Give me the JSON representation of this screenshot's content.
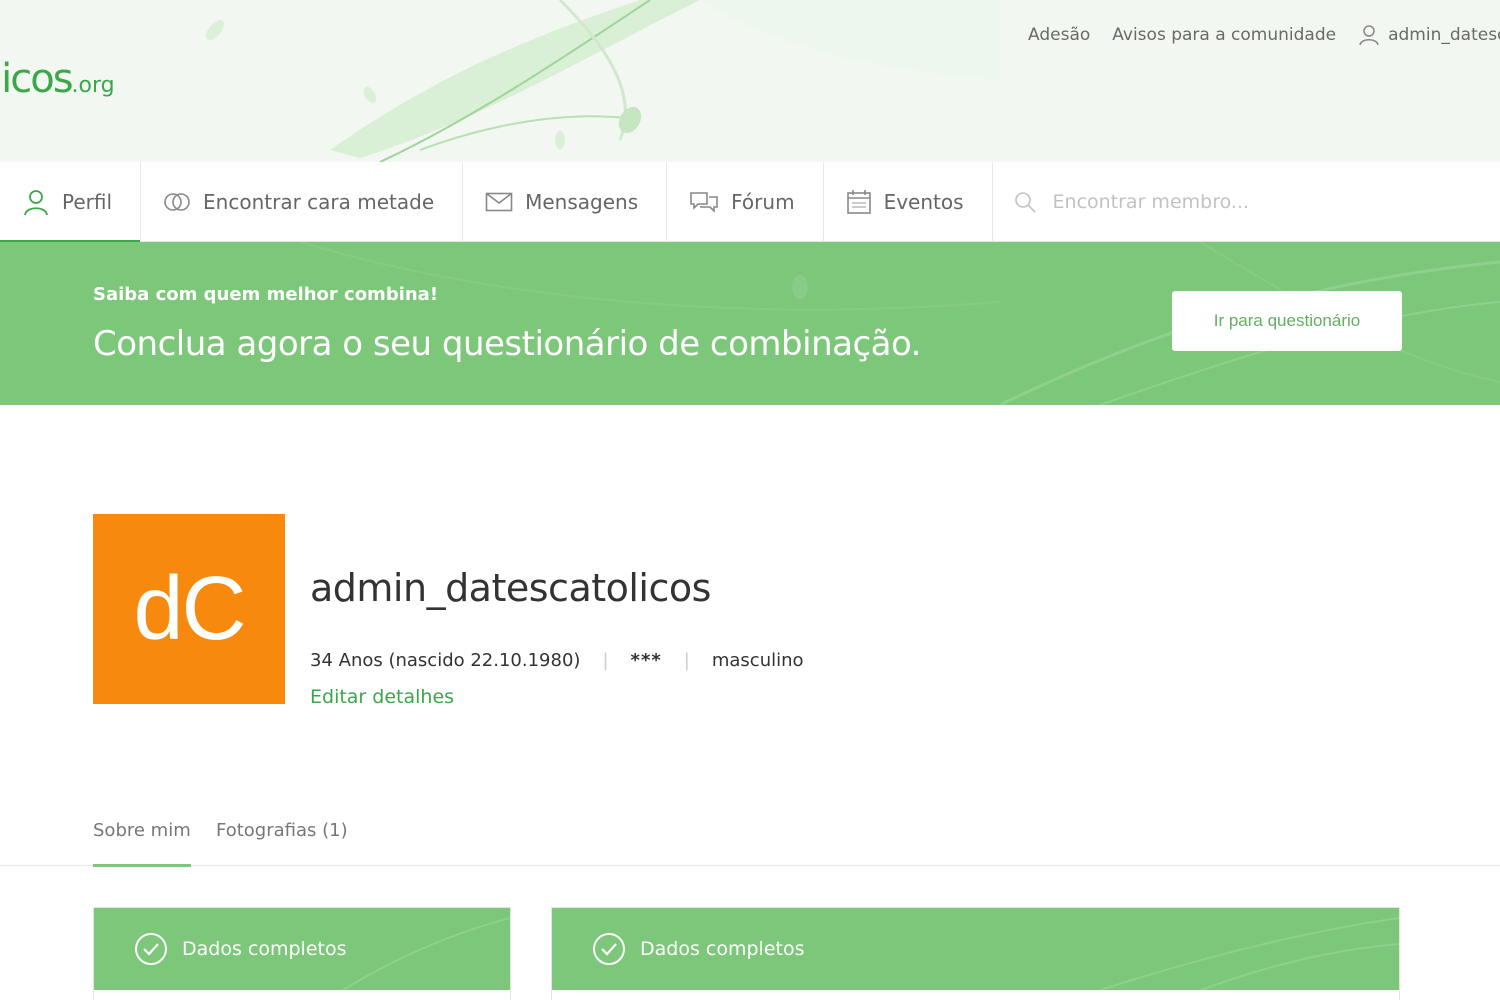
{
  "header": {
    "logo_main": "licos",
    "logo_tld": ".org",
    "links": [
      "Adesão",
      "Avisos para a comunidade"
    ],
    "user_label": "admin_datescatolicos"
  },
  "nav": {
    "items": [
      {
        "label": "Perfil",
        "icon": "user-icon",
        "active": true
      },
      {
        "label": "Encontrar cara metade",
        "icon": "rings-icon",
        "active": false
      },
      {
        "label": "Mensagens",
        "icon": "envelope-icon",
        "active": false
      },
      {
        "label": "Fórum",
        "icon": "speech-bubbles-icon",
        "active": false
      },
      {
        "label": "Eventos",
        "icon": "calendar-icon",
        "active": false
      }
    ],
    "search_placeholder": "Encontrar membro..."
  },
  "banner": {
    "small": "Saiba com quem melhor combina!",
    "big": "Conclua agora o seu questionário de combinação.",
    "button": "Ir para questionário"
  },
  "profile": {
    "avatar_initials": "dC",
    "username": "admin_datescatolicos",
    "age": "34 Anos (nascido 22.10.1980)",
    "stars": "***",
    "gender": "masculino",
    "edit": "Editar detalhes"
  },
  "tabs": [
    {
      "label": "Sobre mim",
      "active": true
    },
    {
      "label": "Fotografias (1)",
      "active": false
    }
  ],
  "cards": [
    {
      "title": "Dados completos",
      "icon": "check-circle-icon"
    },
    {
      "title": "Dados completos",
      "icon": "check-circle-icon"
    }
  ],
  "colors": {
    "brand_green": "#3aa74a",
    "banner_green": "#7cc77a",
    "avatar_orange": "#f7890f"
  }
}
